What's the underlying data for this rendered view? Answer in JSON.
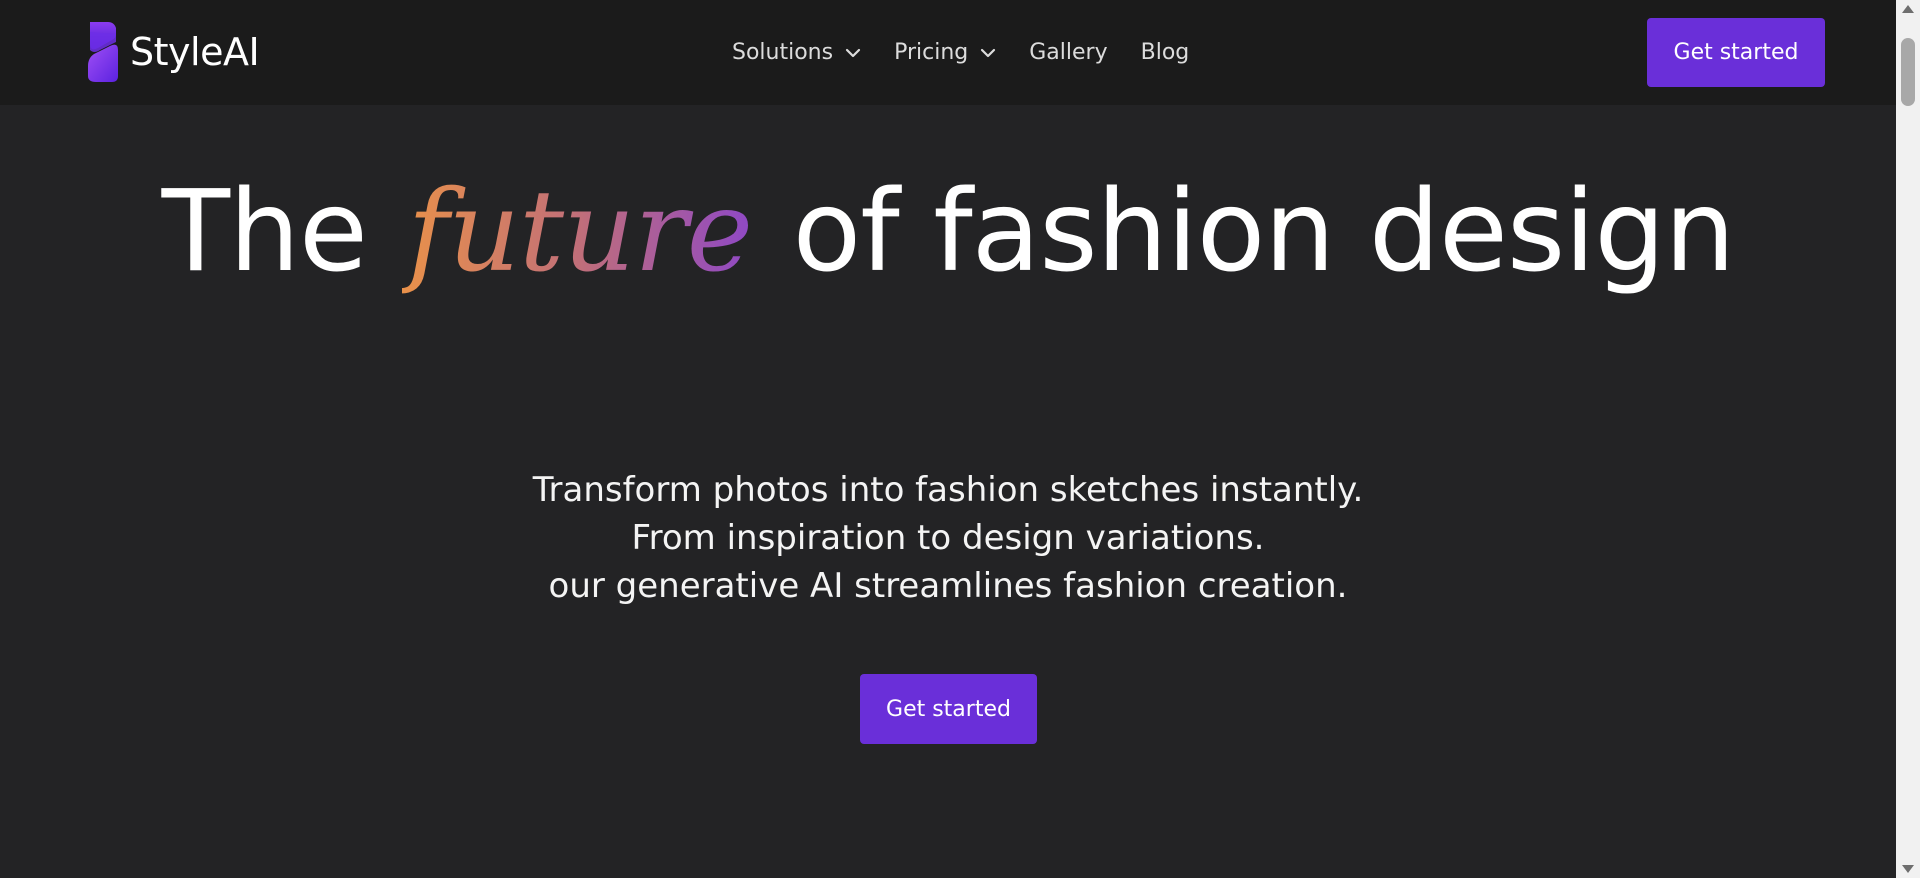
{
  "brand": {
    "name": "StyleAI",
    "logo_icon": "styleai-logo-icon",
    "colors": {
      "accent": "#6a2fd9",
      "header_bg": "#1b1b1b",
      "page_bg": "#232325",
      "gradient_start": "#e9914a",
      "gradient_end": "#8d47c8"
    }
  },
  "nav": {
    "items": [
      {
        "label": "Solutions",
        "has_dropdown": true
      },
      {
        "label": "Pricing",
        "has_dropdown": true
      },
      {
        "label": "Gallery",
        "has_dropdown": false
      },
      {
        "label": "Blog",
        "has_dropdown": false
      }
    ],
    "dropdown_icon": "chevron-down-icon"
  },
  "header": {
    "cta_label": "Get started"
  },
  "hero": {
    "title_before": "The",
    "title_accent": "future",
    "title_after": "of fashion design",
    "subtitle_lines": [
      "Transform photos into fashion sketches instantly.",
      "From inspiration to design variations.",
      "our generative AI streamlines fashion creation."
    ],
    "cta_label": "Get started"
  }
}
